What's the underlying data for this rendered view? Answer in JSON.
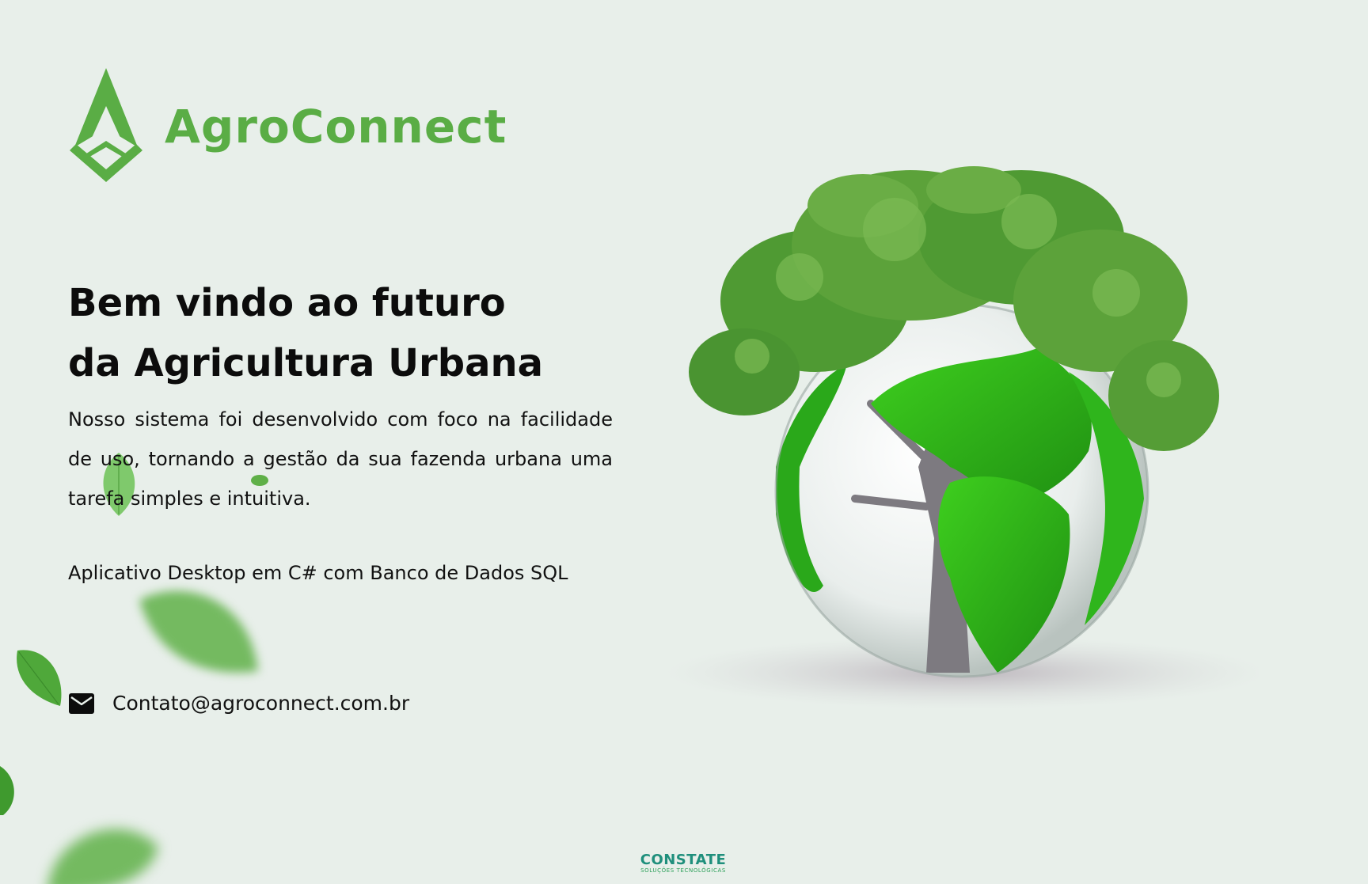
{
  "brand": {
    "name": "AgroConnect",
    "logo_icon": "arrow-diamond-logo-icon",
    "color": "#5aad45"
  },
  "hero": {
    "headline_line1": "Bem vindo ao futuro",
    "headline_line2": "da Agricultura Urbana",
    "description": "Nosso sistema foi desenvolvido com foco na facilidade de uso, tornando a gestão da sua fazenda urbana uma tarefa simples e intuitiva.",
    "tech": "Aplicativo Desktop em C# com Banco de Dados SQL",
    "image": "globe-with-tree-illustration"
  },
  "contact": {
    "icon": "mail-icon",
    "email": "Contato@agroconnect.com.br"
  },
  "footer": {
    "company": "CONSTATE",
    "tagline": "SOLUÇÕES TECNOLÓGICAS",
    "colors": {
      "primary": "#1f8f7c",
      "secondary": "#2da05a"
    }
  },
  "colors": {
    "background": "#e8efea",
    "accent": "#5aad45",
    "text": "#0c0c0c"
  }
}
